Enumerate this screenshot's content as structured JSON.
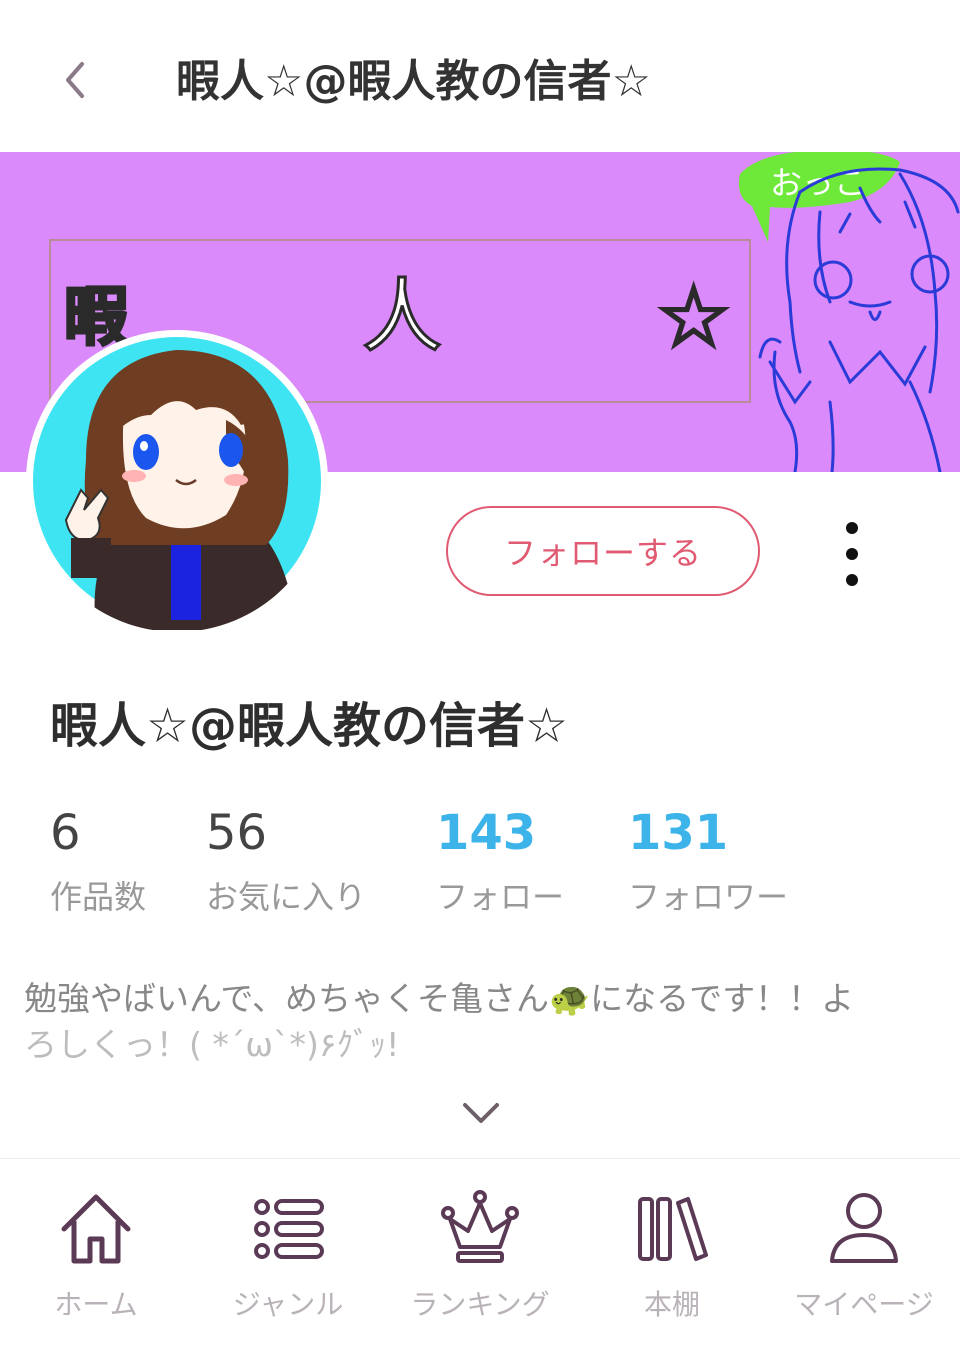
{
  "header": {
    "title": "暇人☆@暇人教の信者☆"
  },
  "banner": {
    "chars": [
      "暇",
      "人",
      "☆"
    ],
    "bubble_text": "おっこ"
  },
  "profile": {
    "name": "暇人☆@暇人教の信者☆",
    "follow_label": "フォローする",
    "stats": [
      {
        "value": "6",
        "label": "作品数"
      },
      {
        "value": "56",
        "label": "お気に入り"
      },
      {
        "value": "143",
        "label": "フォロー"
      },
      {
        "value": "131",
        "label": "フォロワー"
      }
    ],
    "bio_line1": "勉強やばいんで、めちゃくそ亀さん🐢になるです！！よ",
    "bio_line2": "ろしくっ！( *´ω`*)۶ｸﾞｯ!"
  },
  "nav": {
    "items": [
      {
        "label": "ホーム",
        "icon": "home-icon"
      },
      {
        "label": "ジャンル",
        "icon": "list-icon"
      },
      {
        "label": "ランキング",
        "icon": "crown-icon"
      },
      {
        "label": "本棚",
        "icon": "bookshelf-icon"
      },
      {
        "label": "マイページ",
        "icon": "user-icon"
      }
    ]
  },
  "colors": {
    "banner": "#da8afb",
    "accent_red": "#e05a72",
    "accent_blue": "#3cb4ea",
    "nav_icon": "#5a3a55"
  }
}
